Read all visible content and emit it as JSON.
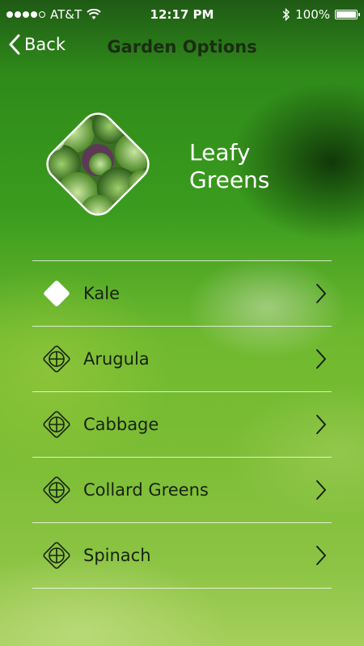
{
  "status_bar": {
    "carrier": "AT&T",
    "time": "12:17 PM",
    "battery_percent": "100%",
    "signal_bars_filled": 4,
    "signal_bars_total": 5,
    "icons": [
      "wifi-icon",
      "bluetooth-icon",
      "battery-icon"
    ]
  },
  "nav": {
    "back_label": "Back",
    "title": "Garden Options"
  },
  "category": {
    "title": "Leafy Greens",
    "image_description_icon": "kale-photo"
  },
  "items": [
    {
      "label": "Kale",
      "state": "selected",
      "icon": "filled-diamond-icon"
    },
    {
      "label": "Arugula",
      "state": "add",
      "icon": "diamond-plus-icon"
    },
    {
      "label": "Cabbage",
      "state": "add",
      "icon": "diamond-plus-icon"
    },
    {
      "label": "Collard Greens",
      "state": "add",
      "icon": "diamond-plus-icon"
    },
    {
      "label": "Spinach",
      "state": "add",
      "icon": "diamond-plus-icon"
    }
  ],
  "colors": {
    "text_dark": "#172311",
    "nav_title": "#1b2d12",
    "white": "#ffffff"
  }
}
